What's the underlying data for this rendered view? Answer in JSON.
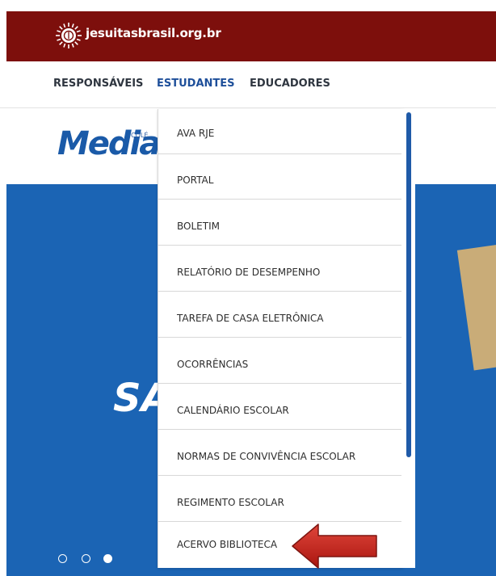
{
  "header": {
    "site_name": "jesuitasbrasil.org.br",
    "bg_color": "#7d0f0c",
    "logo_icon": "jesuit-seal-icon"
  },
  "nav": {
    "items": [
      {
        "label": "RESPONSÁVEIS",
        "active": false
      },
      {
        "label": "ESTUDANTES",
        "active": true
      },
      {
        "label": "EDUCADORES",
        "active": false
      }
    ]
  },
  "brand": {
    "text": "Median",
    "small_text": "COLÉ"
  },
  "hero": {
    "text": "SA",
    "bg_color": "#1b64b4",
    "carousel_dots": [
      false,
      false,
      true
    ]
  },
  "dropdown": {
    "items": [
      "AVA RJE",
      "PORTAL",
      "BOLETIM",
      "RELATÓRIO DE DESEMPENHO",
      "TAREFA DE CASA ELETRÔNICA",
      "OCORRÊNCIAS",
      "CALENDÁRIO ESCOLAR",
      "NORMAS DE CONVIVÊNCIA ESCOLAR",
      "REGIMENTO ESCOLAR",
      "ACERVO BIBLIOTECA"
    ]
  },
  "annotation": {
    "arrow_color": "#c8221a",
    "points_to": "ACERVO BIBLIOTECA"
  }
}
